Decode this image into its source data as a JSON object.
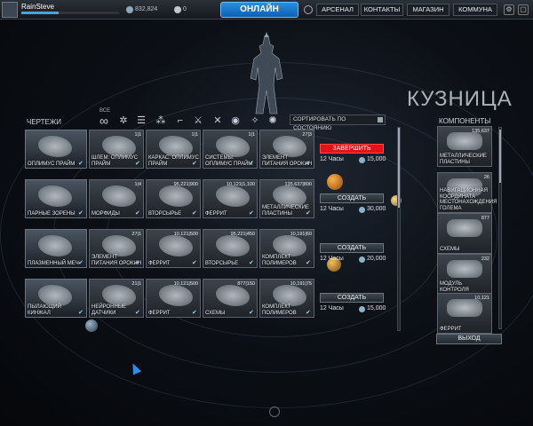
{
  "topbar": {
    "username": "RainSteve",
    "xp_progress": 0.38,
    "credits": "832,824",
    "platinum": "0",
    "online_label": "ОНЛАЙН",
    "tabs": [
      "АРСЕНАЛ",
      "КОНТАКТЫ",
      "МАГАЗИН",
      "КОММУНА"
    ]
  },
  "forge": {
    "title": "КУЗНИЦА",
    "blueprints_title": "ЧЕРТЕЖИ",
    "components_title": "КОМПОНЕНТЫ",
    "filter_all_label": "ВСЕ",
    "sort_label": "СОРТИРОВАТЬ ПО СОСТОЯНИЮ",
    "exit_label": "ВЫХОД"
  },
  "rows": [
    {
      "blueprint": "ОПЛИМУС ПРАЙМ",
      "parts": [
        {
          "label": "ШЛЕМ: ОПЛИМУС ПРАЙМ",
          "count": "1|1"
        },
        {
          "label": "КАРКАС: ОПЛИМУС ПРАЙМ",
          "count": "1|1"
        },
        {
          "label": "СИСТЕМЫ: ОПЛИМУС ПРАЙМ",
          "count": "1|1"
        },
        {
          "label": "ЭЛЕМЕНТ ПИТАНИЯ ОРОКИН",
          "count": "27|3"
        }
      ],
      "action": "ЗАВЕРШИТЬ",
      "time": "12 Часы",
      "cost": "15,000"
    },
    {
      "blueprint": "ПАРНЫЕ ЗОРЕНЫ",
      "parts": [
        {
          "label": "МОРФИДЫ",
          "count": "1|4"
        },
        {
          "label": "ВТОРСЫРЬЕ",
          "count": "95,221|900"
        },
        {
          "label": "ФЕРРИТ",
          "count": "10,121|1,100"
        },
        {
          "label": "МЕТАЛЛИЧЕСКИЕ ПЛАСТИНЫ",
          "count": "135,637|800"
        }
      ],
      "action": "СОЗДАТЬ",
      "time": "12 Часы",
      "cost": "30,000"
    },
    {
      "blueprint": "ПЛАЗМЕННЫЙ МЕЧ",
      "parts": [
        {
          "label": "ЭЛЕМЕНТ ПИТАНИЯ ОРОКИН",
          "count": "27|1"
        },
        {
          "label": "ФЕРРИТ",
          "count": "10,121|500"
        },
        {
          "label": "ВТОРСЫРЬЕ",
          "count": "95,221|450"
        },
        {
          "label": "КОМПЛЕКТ ПОЛИМЕРОВ",
          "count": "10,191|60"
        }
      ],
      "action": "СОЗДАТЬ",
      "time": "12 Часы",
      "cost": "20,000"
    },
    {
      "blueprint": "ПЫЛАЮЩИЙ КИНЖАЛ",
      "parts": [
        {
          "label": "НЕЙРОННЫЕ ДАТЧИКИ",
          "count": "21|1"
        },
        {
          "label": "ФЕРРИТ",
          "count": "10,121|500"
        },
        {
          "label": "СХЕМЫ",
          "count": "877|150"
        },
        {
          "label": "КОМПЛЕКТ ПОЛИМЕРОВ",
          "count": "10,191|75"
        }
      ],
      "action": "СОЗДАТЬ",
      "time": "12 Часы",
      "cost": "15,000"
    }
  ],
  "components": [
    {
      "label": "МЕТАЛЛИЧЕСКИЕ ПЛАСТИНЫ",
      "count": "135,637"
    },
    {
      "label": "НАВИГАЦИОННАЯ КООРДИНАТА МЕСТОНАХОЖДЕНИЯ ГОЛЕМА",
      "count": "26"
    },
    {
      "label": "СХЕМЫ",
      "count": "877"
    },
    {
      "label": "МОДУЛЬ КОНТРОЛЯ",
      "count": "232"
    },
    {
      "label": "ФЕРРИТ",
      "count": "10,121"
    }
  ],
  "colors": {
    "accent": "#2a8ee0",
    "complete": "#e0121b"
  }
}
